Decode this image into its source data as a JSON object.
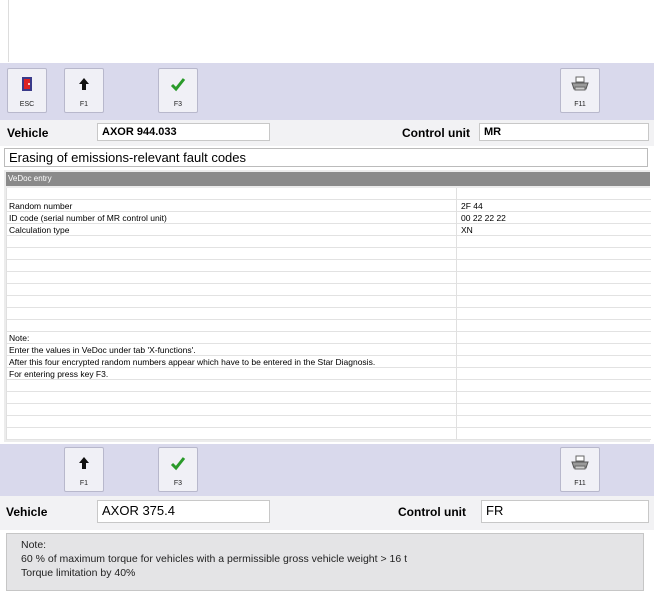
{
  "toolbar_top": {
    "buttons": [
      {
        "key": "ESC",
        "icon": "exit-door-icon"
      },
      {
        "key": "F1",
        "icon": "arrow-up-icon"
      },
      {
        "key": "F3",
        "icon": "checkmark-icon"
      },
      {
        "key": "F11",
        "icon": "printer-icon"
      }
    ]
  },
  "info_top": {
    "vehicle_label": "Vehicle",
    "vehicle_value": "AXOR 944.033",
    "control_unit_label": "Control unit",
    "control_unit_value": "MR"
  },
  "page_title": "Erasing of emissions-relevant fault codes",
  "vedoc": {
    "header": "VeDoc entry",
    "rows": [
      {
        "label": "",
        "value": ""
      },
      {
        "label": "Random number",
        "value": "2F 44"
      },
      {
        "label": "ID code (serial number of MR control unit)",
        "value": "00 22 22 22"
      },
      {
        "label": "Calculation type",
        "value": "XN"
      },
      {
        "label": "",
        "value": ""
      },
      {
        "label": "",
        "value": ""
      },
      {
        "label": "",
        "value": ""
      },
      {
        "label": "",
        "value": ""
      },
      {
        "label": "",
        "value": ""
      },
      {
        "label": "",
        "value": ""
      },
      {
        "label": "",
        "value": ""
      },
      {
        "label": "",
        "value": ""
      },
      {
        "label": "Note:",
        "value": ""
      },
      {
        "label": "Enter the values in VeDoc under tab 'X-functions'.",
        "value": ""
      },
      {
        "label": "After this four encrypted random numbers appear which have to be entered in the Star Diagnosis.",
        "value": ""
      },
      {
        "label": "For entering press key F3.",
        "value": ""
      }
    ]
  },
  "toolbar_bottom": {
    "buttons": [
      {
        "key": "F1",
        "icon": "arrow-up-icon"
      },
      {
        "key": "F3",
        "icon": "checkmark-icon"
      },
      {
        "key": "F11",
        "icon": "printer-icon"
      }
    ]
  },
  "info_bottom": {
    "vehicle_label": "Vehicle",
    "vehicle_value": "AXOR 375.4",
    "control_unit_label": "Control unit",
    "control_unit_value": "FR"
  },
  "note": {
    "lines": [
      "Note:",
      "60 % of maximum torque for vehicles with a permissible gross vehicle weight > 16 t",
      "Torque limitation by 40%"
    ]
  },
  "colors": {
    "toolbar_bg": "#d9d9ec",
    "vedoc_header_bg": "#8a8a8a",
    "check_green": "#2a9a2a"
  }
}
